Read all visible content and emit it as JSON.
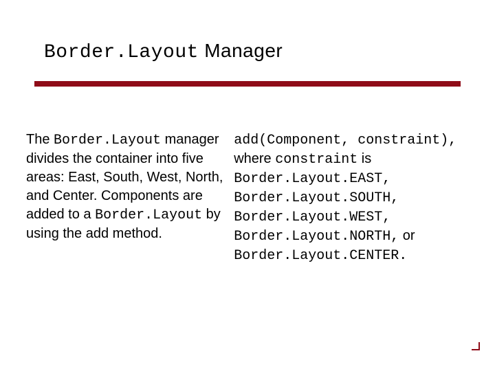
{
  "title": {
    "mono_part": "Border.Layout",
    "rest": " Manager"
  },
  "divider_color": "#8f0c18",
  "left_column": {
    "segments": [
      {
        "text": "The ",
        "mono": false
      },
      {
        "text": "Border.Layout",
        "mono": true
      },
      {
        "text": " manager divides the container into five areas: East, South, West, North, and Center. Components are added to a ",
        "mono": false
      },
      {
        "text": "Border.Layout",
        "mono": true
      },
      {
        "text": " by using the add method.",
        "mono": false
      }
    ]
  },
  "right_column": {
    "lines": [
      [
        {
          "text": "add(Component, constraint),",
          "mono": true
        }
      ],
      [
        {
          "text": "where ",
          "mono": false
        },
        {
          "text": "constraint",
          "mono": true
        },
        {
          "text": " is",
          "mono": false
        }
      ],
      [
        {
          "text": "Border.Layout.EAST,",
          "mono": true
        }
      ],
      [
        {
          "text": "Border.Layout.SOUTH,",
          "mono": true
        }
      ],
      [
        {
          "text": "Border.Layout.WEST,",
          "mono": true
        }
      ],
      [
        {
          "text": "Border.Layout.NORTH,",
          "mono": true
        },
        {
          "text": " or",
          "mono": false
        }
      ],
      [
        {
          "text": "Border.Layout.CENTER.",
          "mono": true
        }
      ]
    ]
  }
}
